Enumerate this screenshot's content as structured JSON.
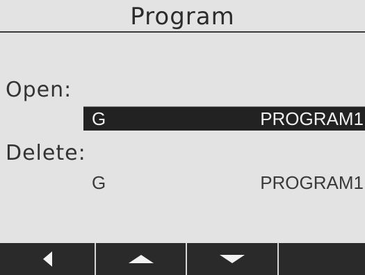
{
  "header": {
    "title": "Program"
  },
  "open": {
    "label": "Open:",
    "prefix": "G",
    "program": "PROGRAM1"
  },
  "delete": {
    "label": "Delete:",
    "prefix": "G",
    "program": "PROGRAM1"
  },
  "toolbar": {
    "buttons": [
      {
        "icon": "arrow-left-icon"
      },
      {
        "icon": "arrow-up-icon"
      },
      {
        "icon": "arrow-down-icon"
      },
      {
        "icon": ""
      }
    ]
  },
  "colors": {
    "background": "#e3e3e3",
    "selection": "#222222",
    "toolbar": "#2a2a2a",
    "text": "#2a2a2a"
  }
}
